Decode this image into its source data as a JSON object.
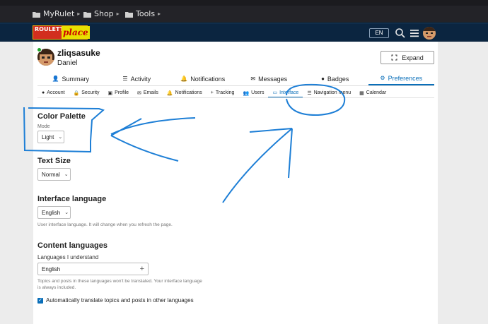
{
  "browser": {
    "bookmarks": [
      {
        "label": "MyRulet"
      },
      {
        "label": "Shop"
      },
      {
        "label": "Tools"
      }
    ]
  },
  "header": {
    "logo_top": "ROULETTE",
    "logo_bottom": "place",
    "lang": "EN"
  },
  "profile": {
    "username": "zliqsasuke",
    "realname": "Daniel",
    "expand_label": "Expand"
  },
  "main_tabs": [
    {
      "label": "Summary"
    },
    {
      "label": "Activity"
    },
    {
      "label": "Notifications"
    },
    {
      "label": "Messages"
    },
    {
      "label": "Badges"
    },
    {
      "label": "Preferences"
    }
  ],
  "sub_tabs": [
    {
      "label": "Account"
    },
    {
      "label": "Security"
    },
    {
      "label": "Profile"
    },
    {
      "label": "Emails"
    },
    {
      "label": "Notifications"
    },
    {
      "label": "Tracking"
    },
    {
      "label": "Users"
    },
    {
      "label": "Interface"
    },
    {
      "label": "Navigation menu"
    },
    {
      "label": "Calendar"
    }
  ],
  "interface": {
    "color_palette": {
      "title": "Color Palette",
      "mode_label": "Mode",
      "value": "Light"
    },
    "text_size": {
      "title": "Text Size",
      "value": "Normal"
    },
    "interface_language": {
      "title": "Interface language",
      "value": "English",
      "help": "User interface language. It will change when you refresh the page."
    },
    "content_languages": {
      "title": "Content languages",
      "label": "Languages I understand",
      "value": "English",
      "help_1": "Topics and posts in these languages won't be translated. Your interface language",
      "help_2": "is always included."
    },
    "auto_translate_label": "Automatically translate topics and posts in other languages"
  },
  "colors": {
    "accent": "#0a6fb9",
    "header_bg": "#0b2540",
    "annotation": "#1e7fd6"
  }
}
